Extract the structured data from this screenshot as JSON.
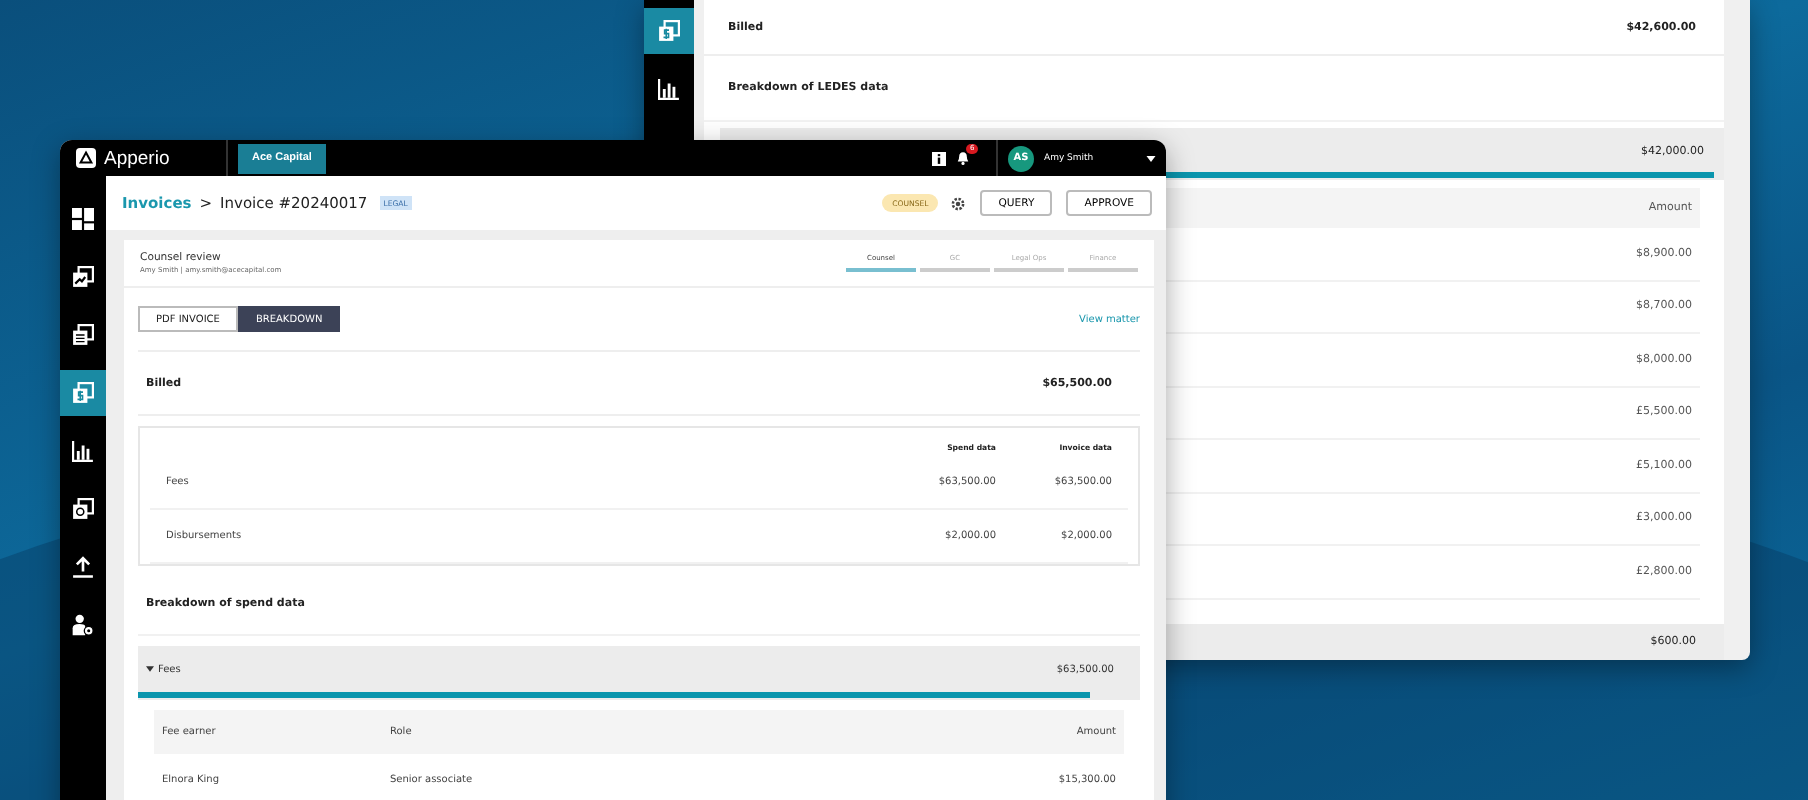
{
  "back_window": {
    "sidebar": {
      "items": [
        {
          "kind": "invoice",
          "selected": true
        },
        {
          "kind": "chart",
          "selected": false
        }
      ]
    },
    "billed": {
      "label": "Billed",
      "amount": "$42,600.00"
    },
    "section_title": "Breakdown of LEDES data",
    "group": {
      "amount": "$42,000.00",
      "level": 0.99
    },
    "table": {
      "columns": [
        "Amount"
      ],
      "rows": [
        {
          "amount": "$8,900.00"
        },
        {
          "amount": "$8,700.00"
        },
        {
          "amount": "$8,000.00"
        },
        {
          "amount": "£5,500.00"
        },
        {
          "amount": "£5,100.00"
        },
        {
          "amount": "£3,000.00"
        },
        {
          "amount": "£2,800.00"
        }
      ]
    },
    "next_group": {
      "amount": "$600.00"
    }
  },
  "front_window": {
    "top_bar": {
      "logo": "Apperio",
      "client_tab": "Ace Capital",
      "notifications": "6",
      "user": {
        "initials": "AS",
        "name": "Amy Smith"
      }
    },
    "sidebar": {
      "items": [
        {
          "kind": "grid",
          "selected": false
        },
        {
          "kind": "trend",
          "selected": false
        },
        {
          "kind": "documents",
          "selected": false
        },
        {
          "kind": "invoice",
          "selected": true
        },
        {
          "kind": "chart",
          "selected": false
        },
        {
          "kind": "copy",
          "selected": false
        },
        {
          "kind": "upload",
          "selected": false
        },
        {
          "kind": "user",
          "selected": false
        }
      ]
    },
    "breadcrumb": {
      "link": "Invoices",
      "separator": ">",
      "current": "Invoice #20240017",
      "tag": "LEGAL"
    },
    "status": "COUNSEL",
    "buttons": [
      "QUERY",
      "APPROVE"
    ],
    "review": {
      "title": "Counsel review",
      "subtitle": "Amy Smith | amy.smith@acecapital.com"
    },
    "steps": [
      {
        "label": "Counsel",
        "selected": true
      },
      {
        "label": "GC",
        "selected": false
      },
      {
        "label": "Legal Ops",
        "selected": false
      },
      {
        "label": "Finance",
        "selected": false
      }
    ],
    "view_tabs": [
      {
        "label": "PDF INVOICE",
        "selected": false
      },
      {
        "label": "BREAKDOWN",
        "selected": true
      }
    ],
    "view_link": "View matter",
    "billed": {
      "label": "Billed",
      "amount": "$65,500.00"
    },
    "summary_table": {
      "columns": [
        "Spend data",
        "Invoice data"
      ],
      "rows": [
        {
          "label": "Fees",
          "spend": "$63,500.00",
          "invoice": "$63,500.00"
        },
        {
          "label": "Disbursements",
          "spend": "$2,000.00",
          "invoice": "$2,000.00"
        }
      ]
    },
    "spend_title": "Breakdown of spend data",
    "group": {
      "label": "Fees",
      "expanded": true,
      "amount": "$63,500.00",
      "level": 0.95
    },
    "fee_table": {
      "columns": [
        "Fee earner",
        "Role",
        "Amount"
      ],
      "rows": [
        [
          "Elnora King",
          "Senior associate",
          "$15,300.00"
        ]
      ]
    }
  }
}
